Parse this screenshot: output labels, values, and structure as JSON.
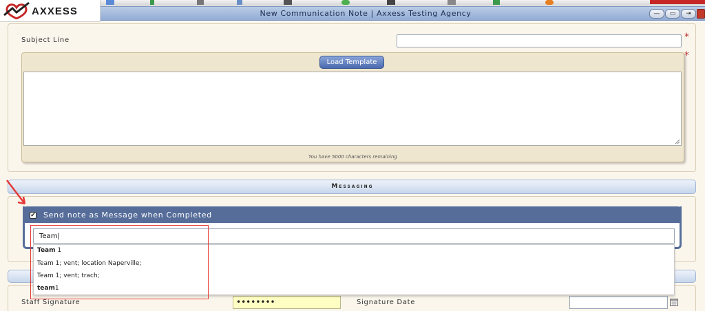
{
  "app": {
    "logo_text": "AXXESS"
  },
  "window": {
    "title": "New Communication Note | Axxess Testing Agency",
    "buttons": {
      "minimize": "—",
      "restore": "▭",
      "pin": "⇥",
      "close": "✕"
    }
  },
  "subject": {
    "label": "Subject Line",
    "value": "",
    "required_mark": "*"
  },
  "note": {
    "load_template_label": "Load Template",
    "required_mark": "*",
    "text": "",
    "remaining_text": "You have 5000 characters remaining"
  },
  "messaging": {
    "section_title": "Messaging",
    "send_as_message_label": "Send note as Message when Completed",
    "send_as_message_checked": true,
    "checkbox_glyph": "✔",
    "recipient_value": "Team|",
    "suggestions": [
      {
        "bold": "Team",
        "rest": " 1"
      },
      {
        "bold": "",
        "rest": "Team 1; vent; location Naperville;"
      },
      {
        "bold": "",
        "rest": "Team 1; vent; trach;"
      },
      {
        "bold": "team",
        "rest": "1"
      }
    ]
  },
  "signature": {
    "staff_label": "Staff Signature",
    "staff_value": "••••••••",
    "date_label": "Signature Date",
    "date_value": ""
  },
  "colors": {
    "accent_blue": "#566d9a",
    "button_blue": "#4a6ab0",
    "annotation_red": "#e53935",
    "panel_beige": "#efe6cf"
  },
  "icons": [
    "logo-heart-icon",
    "checkbox-checked-icon",
    "calendar-icon",
    "resize-grip-icon",
    "annotation-arrow-icon"
  ]
}
